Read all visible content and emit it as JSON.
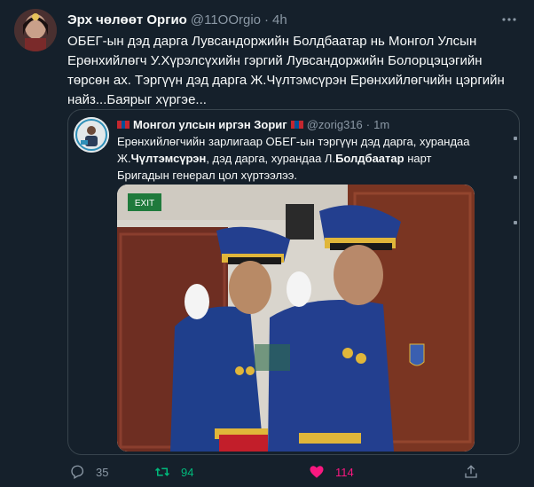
{
  "tweet": {
    "author_name": "Эрх чөлөөт Оргио",
    "author_handle": "@11OOrgio",
    "separator": "·",
    "time": "4h",
    "text_lines": [
      "ОБЕГ-ын дэд дарга Лувсандоржийн Болдбаатар нь Монгол Улсын",
      "Ерөнхийлөгч У.Хүрэлсүхийн гэргий Лувсандоржийн Болорцэцэгийн",
      "төрсөн ах. Тэргүүн дэд дарга Ж.Чүлтэмсүрэн Ерөнхийлөгчийн цэргийн",
      "найз...Баярыг хүргэе..."
    ],
    "more_icon": "more-icon"
  },
  "quote": {
    "author_name": "Монгол улсын иргэн Зориг",
    "author_handle": "@zorig316",
    "separator": "·",
    "time": "1m",
    "text": {
      "line1": "Ерөнхийлөгчийн зарлигаар ОБЕГ-ын тэргүүн дэд дарга, хурандаа",
      "line2_a": "Ж.",
      "line2_b": "Чүлтэмсүрэн",
      "line2_c": ", дэд дарга, хурандаа Л.",
      "line2_d": "Болдбаатар",
      "line2_e": " нарт",
      "line3": "Бригадын генерал цол хүртээлээ."
    },
    "image_sign_text": "EXIT"
  },
  "actions": {
    "reply_count": "35",
    "retweet_count": "94",
    "like_count": "114"
  },
  "colors": {
    "background": "#15202b",
    "retweet_active": "#00ba7c",
    "like_active": "#f91880",
    "muted": "#8b98a5"
  }
}
